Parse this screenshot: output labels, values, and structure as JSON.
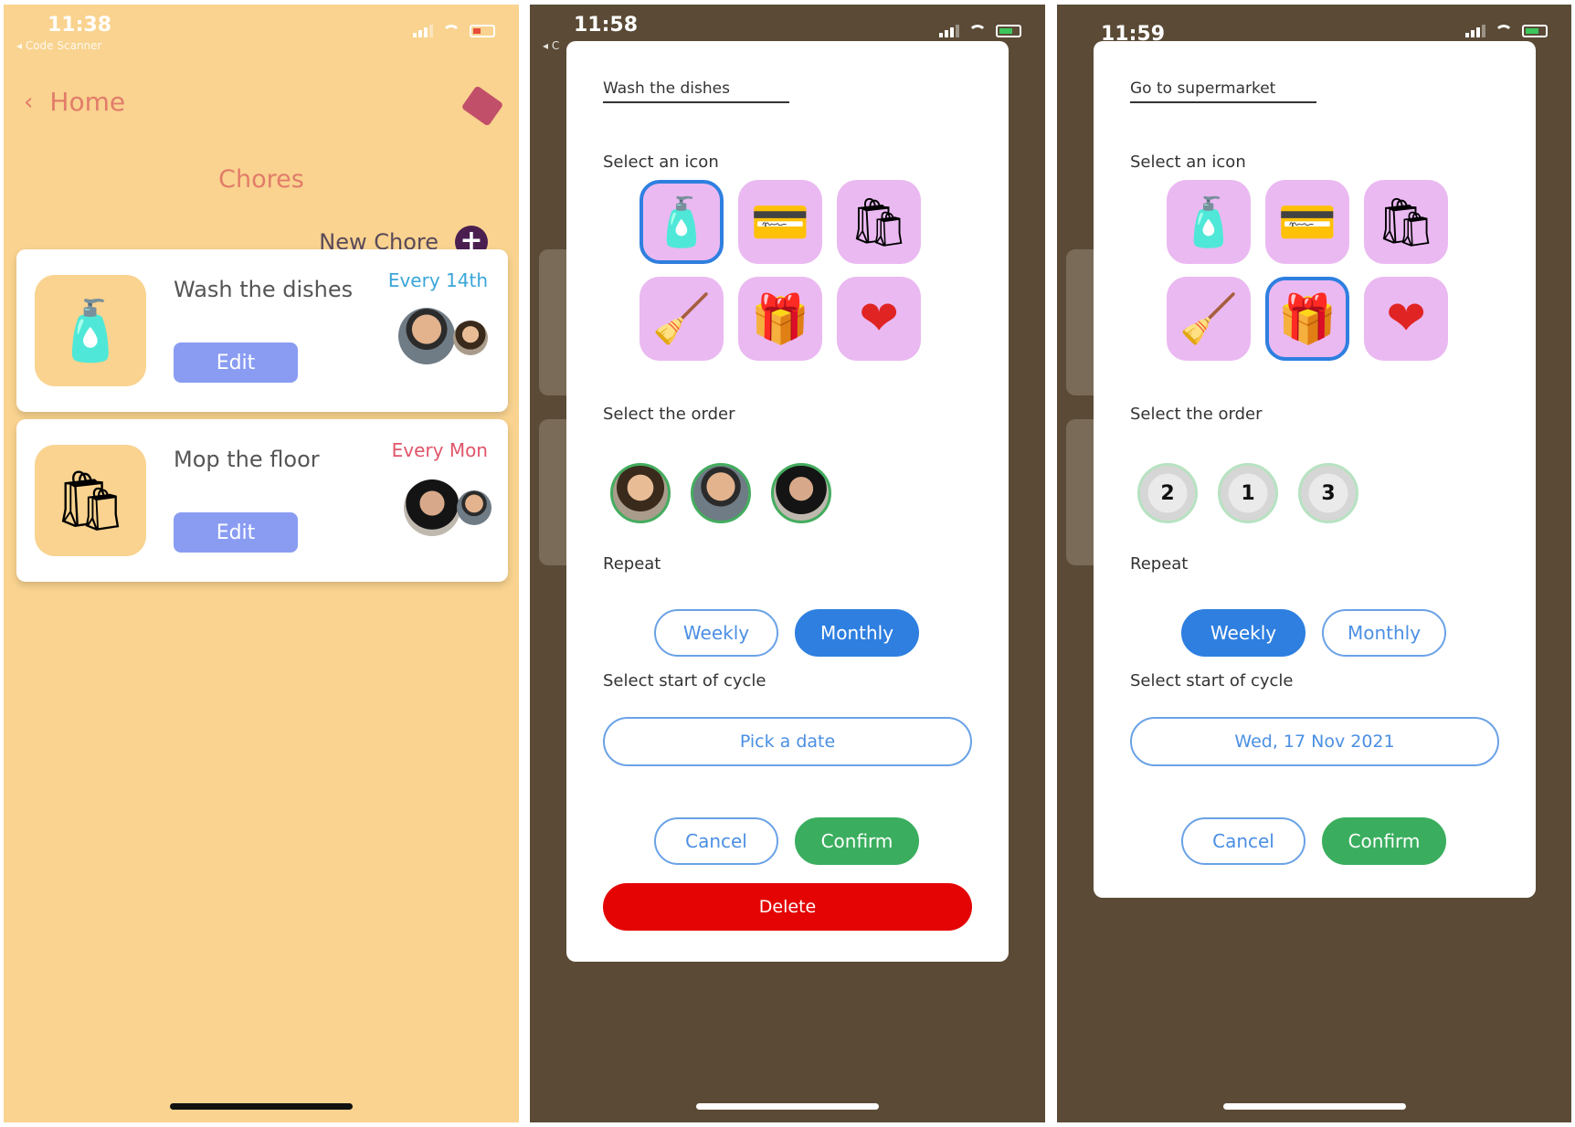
{
  "screens": [
    {
      "status": {
        "time": "11:38",
        "back_app": "◂ Code Scanner"
      },
      "nav": {
        "back_label": "Home"
      },
      "title": "Chores",
      "new_chore_label": "New Chore",
      "chores": [
        {
          "name": "Wash the dishes",
          "frequency": "Every 14th",
          "frequency_color": "#3aa6d8",
          "edit_label": "Edit",
          "icon": "cleaning-bucket-icon"
        },
        {
          "name": "Mop the floor",
          "frequency": "Every Mon",
          "frequency_color": "#e0556a",
          "edit_label": "Edit",
          "icon": "grocery-bag-icon"
        }
      ]
    },
    {
      "status": {
        "time": "11:58",
        "back_app": "◂ C"
      },
      "dialog": {
        "name_value": "Wash the dishes",
        "select_icon_label": "Select an icon",
        "icons": [
          "cleaning-bucket-icon",
          "credit-card-icon",
          "grocery-bag-icon",
          "broom-bucket-icon",
          "shopping-bags-icon",
          "heart-icon"
        ],
        "selected_icon_index": 0,
        "select_order_label": "Select the order",
        "repeat_label": "Repeat",
        "weekly_label": "Weekly",
        "monthly_label": "Monthly",
        "active_repeat": "Monthly",
        "start_cycle_label": "Select start of cycle",
        "date_value": "Pick a date",
        "cancel_label": "Cancel",
        "confirm_label": "Confirm",
        "delete_label": "Delete"
      }
    },
    {
      "status": {
        "time": "11:59"
      },
      "dialog": {
        "name_value": "Go to supermarket",
        "select_icon_label": "Select an icon",
        "icons": [
          "cleaning-bucket-icon",
          "credit-card-icon",
          "grocery-bag-icon",
          "broom-bucket-icon",
          "shopping-bags-icon",
          "heart-icon"
        ],
        "selected_icon_index": 4,
        "select_order_label": "Select the order",
        "order_numbers": [
          "2",
          "1",
          "3"
        ],
        "repeat_label": "Repeat",
        "weekly_label": "Weekly",
        "monthly_label": "Monthly",
        "active_repeat": "Weekly",
        "start_cycle_label": "Select start of cycle",
        "date_value": "Wed, 17 Nov 2021",
        "cancel_label": "Cancel",
        "confirm_label": "Confirm"
      }
    }
  ],
  "colors": {
    "app_bg": "#f9d38f",
    "overlay_bg": "#5a4a36",
    "accent_blue": "#2e7fe0",
    "confirm_green": "#3aae5e",
    "delete_red": "#e40404"
  }
}
